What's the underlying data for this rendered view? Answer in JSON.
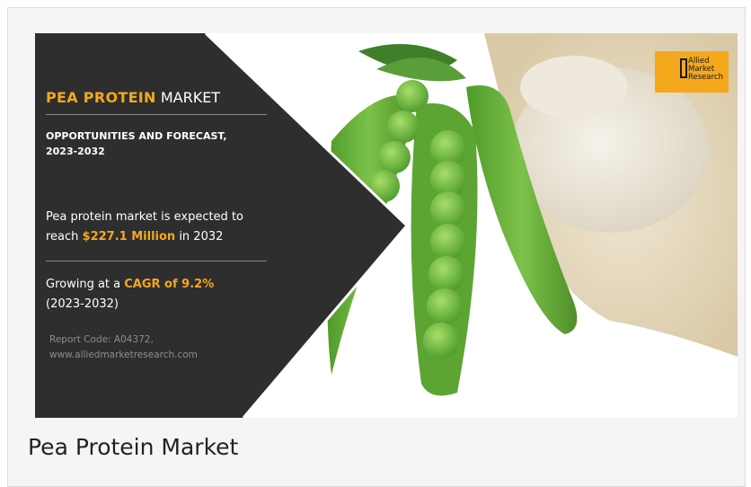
{
  "banner": {
    "title_accent": "PEA PROTEIN",
    "title_rest": " MARKET",
    "forecast_heading": "OPPORTUNITIES AND FORECAST, 2023-2032",
    "expected_text_pre": "Pea protein market is expected to reach ",
    "expected_value": "$227.1 Million",
    "expected_text_post": " in 2032",
    "growth_pre": "Growing at a ",
    "growth_value": "CAGR of 9.2%",
    "growth_period": "(2023-2032)",
    "report_code": "Report Code: A04372,",
    "report_site": "www.alliedmarketresearch.com",
    "logo_line1": "Allied",
    "logo_line2": "Market",
    "logo_line3": "Research"
  },
  "caption": "Pea Protein Market",
  "colors": {
    "panel": "#2e2e2e",
    "accent": "#f5a81c",
    "pea_green": "#6db33f",
    "powder": "#e8dcc4"
  }
}
